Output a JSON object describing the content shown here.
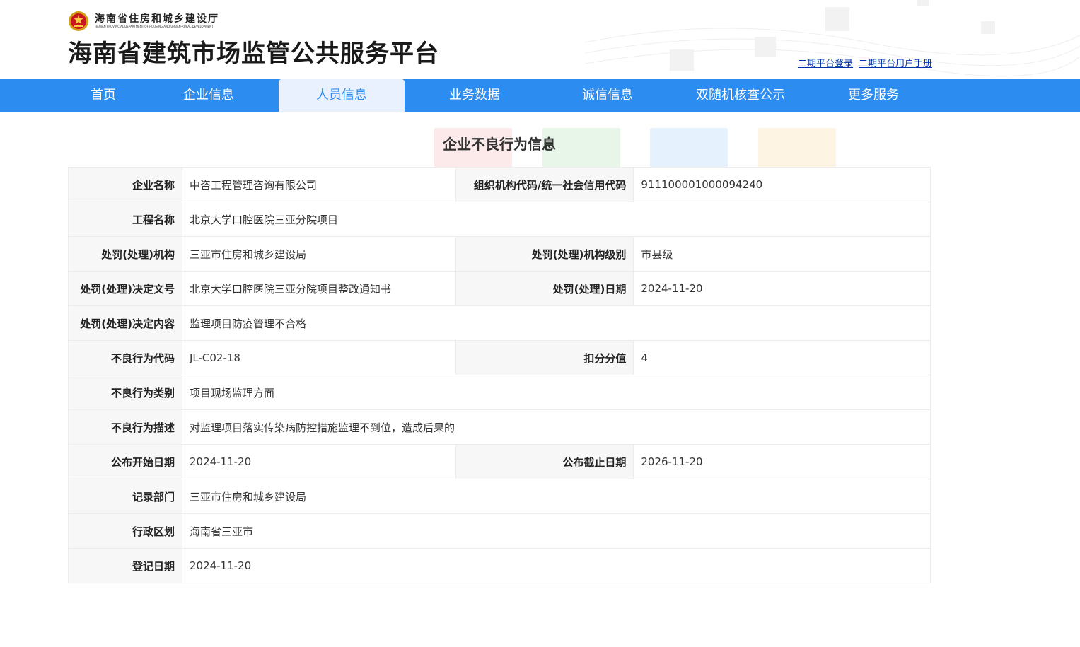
{
  "header": {
    "department_cn": "海南省住房和城乡建设厅",
    "department_en": "HAINAN PROVINCIAL DEPARTMENT OF HOUSING AND URBAN-RURAL DEVELOPMENT",
    "site_title": "海南省建筑市场监管公共服务平台",
    "links": [
      "二期平台登录",
      "二期平台用户手册"
    ]
  },
  "nav": {
    "items": [
      "首页",
      "企业信息",
      "人员信息",
      "业务数据",
      "诚信信息",
      "双随机核查公示",
      "更多服务"
    ],
    "active": "人员信息"
  },
  "section": {
    "title": "企业不良行为信息"
  },
  "colors": {
    "nav_bg": "#2d8cf0",
    "nav_active_bg": "#e8f1fd",
    "label_bg": "#f7f7f7"
  },
  "record": {
    "company_label": "企业名称",
    "company": "中咨工程管理咨询有限公司",
    "org_code_label": "组织机构代码/统一社会信用代码",
    "org_code": "911100001000094240",
    "project_label": "工程名称",
    "project": "北京大学口腔医院三亚分院项目",
    "authority_label": "处罚(处理)机构",
    "authority": "三亚市住房和城乡建设局",
    "authority_level_label": "处罚(处理)机构级别",
    "authority_level": "市县级",
    "decision_no_label": "处罚(处理)决定文号",
    "decision_no": "北京大学口腔医院三亚分院项目整改通知书",
    "decision_date_label": "处罚(处理)日期",
    "decision_date": "2024-11-20",
    "decision_content_label": "处罚(处理)决定内容",
    "decision_content": "监理项目防疫管理不合格",
    "behavior_code_label": "不良行为代码",
    "behavior_code": "JL-C02-18",
    "deduction_label": "扣分分值",
    "deduction": "4",
    "behavior_category_label": "不良行为类别",
    "behavior_category": "项目现场监理方面",
    "behavior_desc_label": "不良行为描述",
    "behavior_desc": "对监理项目落实传染病防控措施监理不到位，造成后果的",
    "publish_start_label": "公布开始日期",
    "publish_start": "2024-11-20",
    "publish_end_label": "公布截止日期",
    "publish_end": "2026-11-20",
    "record_dept_label": "记录部门",
    "record_dept": "三亚市住房和城乡建设局",
    "region_label": "行政区划",
    "region": "海南省三亚市",
    "register_date_label": "登记日期",
    "register_date": "2024-11-20"
  }
}
